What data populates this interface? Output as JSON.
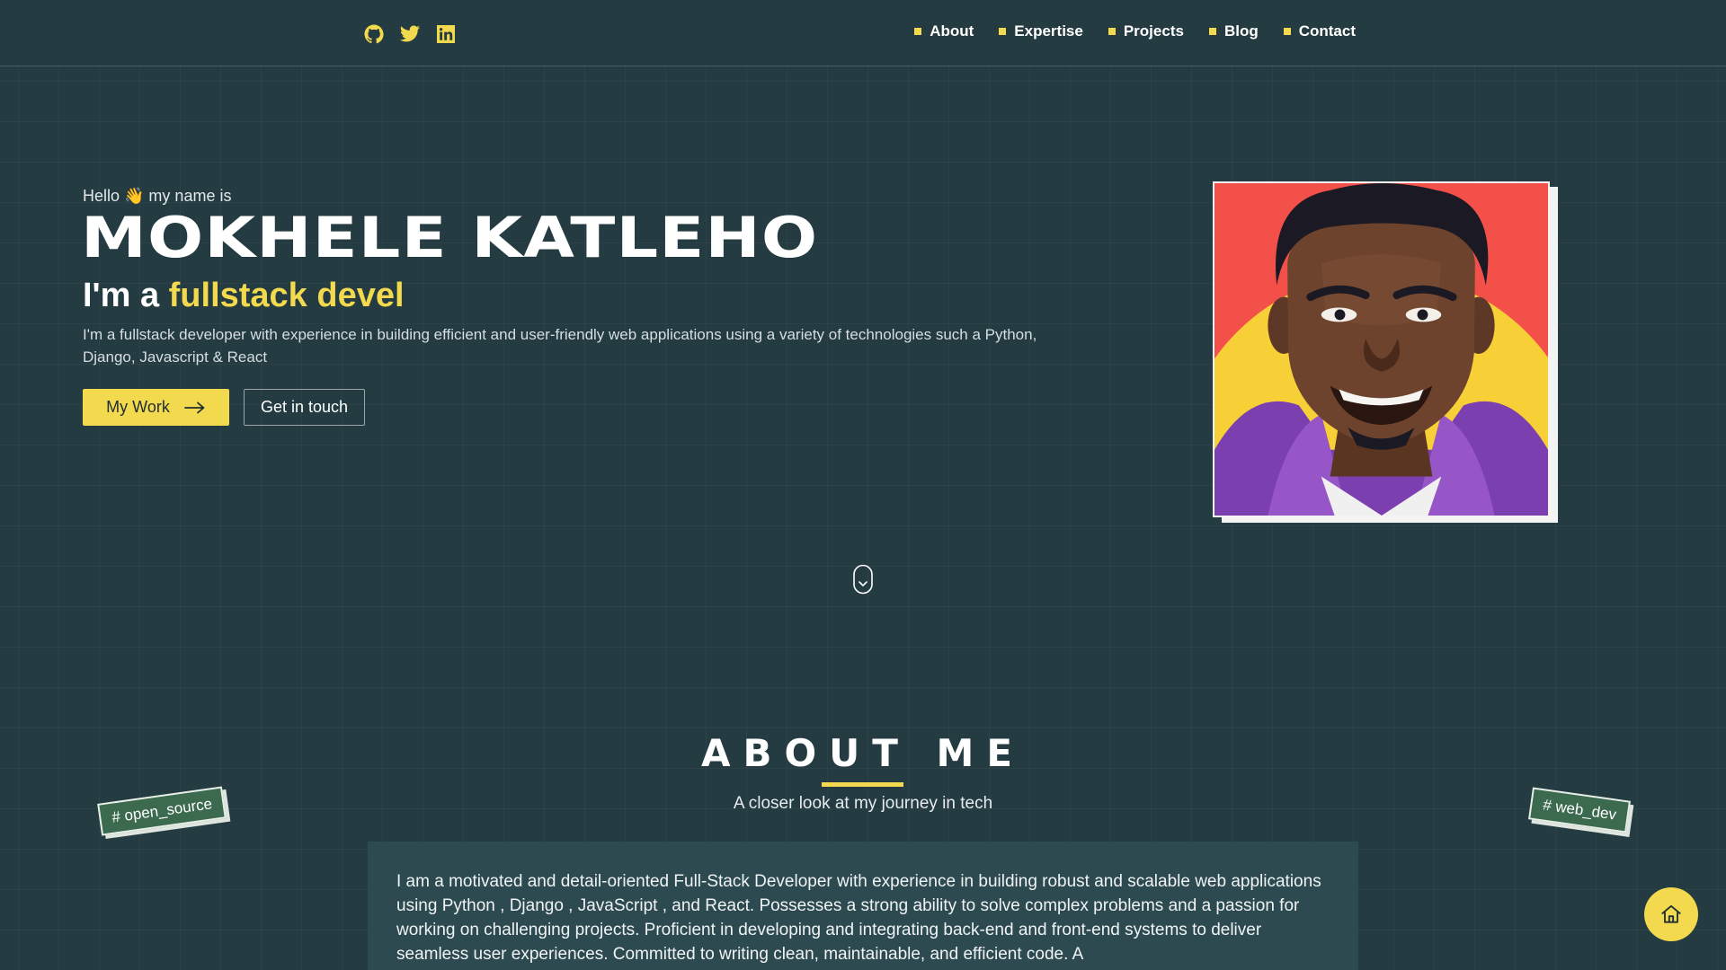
{
  "header": {
    "socials": [
      {
        "name": "github-icon"
      },
      {
        "name": "twitter-icon"
      },
      {
        "name": "linkedin-icon"
      }
    ],
    "nav": [
      {
        "label": "About"
      },
      {
        "label": "Expertise"
      },
      {
        "label": "Projects"
      },
      {
        "label": "Blog"
      },
      {
        "label": "Contact"
      }
    ]
  },
  "hero": {
    "greeting": "Hello 👋 my name is",
    "name": "MOKHELE KATLEHO",
    "role_prefix": "I'm a ",
    "role_highlight": "fullstack devel",
    "description": "I'm a fullstack developer with experience in building efficient and user-friendly web applications using a variety of technologies such a Python, Django, Javascript & React",
    "btn_work": "My Work",
    "btn_touch": "Get in touch"
  },
  "about": {
    "title": "ABOUT ME",
    "subtitle": "A closer look at my journey in tech",
    "tag_left": "# open_source",
    "tag_right": "# web_dev",
    "text": "I am a motivated and detail-oriented Full-Stack Developer with experience in building robust and scalable web applications using Python , Django , JavaScript , and React. Possesses a strong ability to solve complex problems and a passion for working on challenging projects. Proficient in developing and integrating back-end and front-end systems to deliver seamless user experiences. Committed to writing clean, maintainable, and efficient code. A"
  },
  "colors": {
    "background": "#243b41",
    "accent": "#f2d94e",
    "tag_green": "#3b6a4e"
  }
}
